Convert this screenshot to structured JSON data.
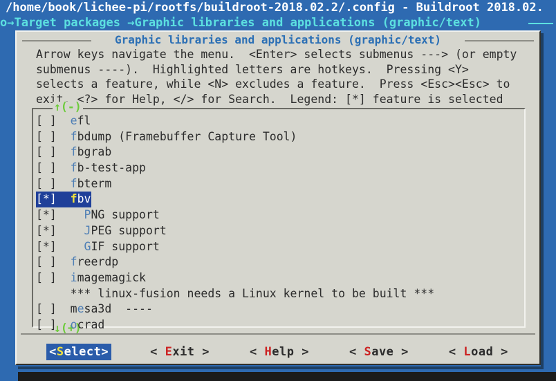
{
  "window": {
    "title": "/home/book/lichee-pi/rootfs/buildroot-2018.02.2/.config - Buildroot 2018.02.",
    "breadcrumb": "o→Target packages →Graphic libraries and applications (graphic/text)"
  },
  "dialog": {
    "title": "Graphic libraries and applications (graphic/text)",
    "help_text": "Arrow keys navigate the menu.  <Enter> selects submenus ---> (or empty\nsubmenus ----).  Highlighted letters are hotkeys.  Pressing <Y>\nselects a feature, while <N> excludes a feature.  Press <Esc><Esc> to\nexit, <?> for Help, </> for Search.  Legend: [*] feature is selected"
  },
  "list": {
    "scroll_up_indicator": "↑(-)",
    "scroll_down_indicator": "↓(+)",
    "items": [
      {
        "prefix": "[ ]  ",
        "hotkey": "e",
        "rest": "fl",
        "selected": false,
        "note": false
      },
      {
        "prefix": "[ ]  ",
        "hotkey": "f",
        "rest": "bdump (Framebuffer Capture Tool)",
        "selected": false,
        "note": false
      },
      {
        "prefix": "[ ]  ",
        "hotkey": "f",
        "rest": "bgrab",
        "selected": false,
        "note": false
      },
      {
        "prefix": "[ ]  ",
        "hotkey": "f",
        "rest": "b-test-app",
        "selected": false,
        "note": false
      },
      {
        "prefix": "[ ]  ",
        "hotkey": "f",
        "rest": "bterm",
        "selected": false,
        "note": false
      },
      {
        "prefix": "[*]  ",
        "hotkey": "f",
        "rest": "bv",
        "selected": true,
        "note": false
      },
      {
        "prefix": "[*]    ",
        "hotkey": "P",
        "rest": "NG support",
        "selected": false,
        "note": false
      },
      {
        "prefix": "[*]    ",
        "hotkey": "J",
        "rest": "PEG support",
        "selected": false,
        "note": false
      },
      {
        "prefix": "[*]    ",
        "hotkey": "G",
        "rest": "IF support",
        "selected": false,
        "note": false
      },
      {
        "prefix": "[ ]  ",
        "hotkey": "f",
        "rest": "reerdp",
        "selected": false,
        "note": false
      },
      {
        "prefix": "[ ]  ",
        "hotkey": "i",
        "rest": "magemagick",
        "selected": false,
        "note": false
      },
      {
        "prefix": "     ",
        "hotkey": "",
        "rest": "*** linux-fusion needs a Linux kernel to be built ***",
        "selected": false,
        "note": true
      },
      {
        "prefix": "[ ]  m",
        "hotkey": "e",
        "rest": "sa3d  ----",
        "selected": false,
        "note": false
      },
      {
        "prefix": "[ ]  ",
        "hotkey": "o",
        "rest": "crad",
        "selected": false,
        "note": false
      }
    ]
  },
  "buttons": [
    {
      "left": "<",
      "hotkey": "S",
      "rest": "elect",
      "right": ">",
      "active": true
    },
    {
      "left": "< ",
      "hotkey": "E",
      "rest": "xit",
      "right": " >",
      "active": false
    },
    {
      "left": "< ",
      "hotkey": "H",
      "rest": "elp",
      "right": " >",
      "active": false
    },
    {
      "left": "< ",
      "hotkey": "S",
      "rest": "ave",
      "right": " >",
      "active": false
    },
    {
      "left": "< ",
      "hotkey": "L",
      "rest": "oad",
      "right": " >",
      "active": false
    }
  ],
  "colors": {
    "desktop_blue": "#2e6ab1",
    "panel_gray": "#d6d6ce",
    "title_cyan": "#5ce0e0",
    "hotkey_blue": "#4f7fb5",
    "hotkey_red": "#cc2222",
    "hotkey_yellow": "#f2e23c",
    "selection_blue": "#1f3f99",
    "button_active_blue": "#2a5caa",
    "scroll_green": "#6ccb3a"
  }
}
